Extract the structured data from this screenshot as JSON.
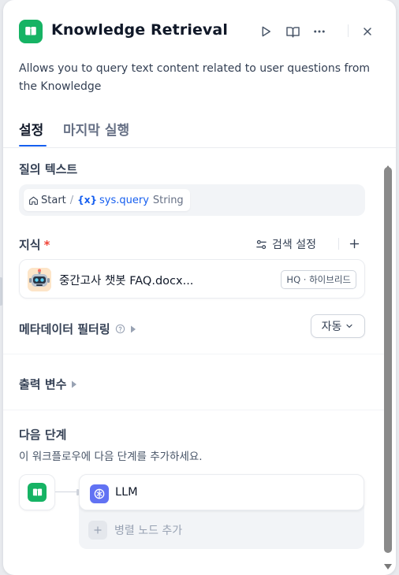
{
  "colors": {
    "accent": "#155eef",
    "node_green": "#16b364",
    "llm_indigo": "#6172f3",
    "required_red": "#f04438"
  },
  "header": {
    "title": "Knowledge Retrieval",
    "icon": "book-open-icon",
    "actions": [
      "play-icon",
      "book-icon",
      "more-icon",
      "close-icon"
    ]
  },
  "description": "Allows you to query text content related to user questions from the Knowledge",
  "tabs": [
    {
      "label": "설정",
      "active": true
    },
    {
      "label": "마지막 실행",
      "active": false
    }
  ],
  "query": {
    "label": "질의 텍스트",
    "chip": {
      "node": "Start",
      "separator": "/",
      "var_prefix": "{x}",
      "variable": "sys.query",
      "type": "String"
    }
  },
  "knowledge": {
    "label": "지식",
    "required_mark": "*",
    "search_settings": "검색 설정",
    "items": [
      {
        "name": "중간고사 챗봇 FAQ.docx...",
        "badge": "HQ · 하이브리드",
        "avatar": "robot-avatar-icon"
      }
    ]
  },
  "metadata_filter": {
    "label": "메타데이터 필터링",
    "value": "자동"
  },
  "output_vars": {
    "label": "출력 변수"
  },
  "next_step": {
    "label": "다음 단계",
    "description": "이 워크플로우에 다음 단계를 추가하세요.",
    "nodes": [
      {
        "label": "LLM"
      }
    ],
    "add_parallel": "병렬 노드 추가"
  }
}
